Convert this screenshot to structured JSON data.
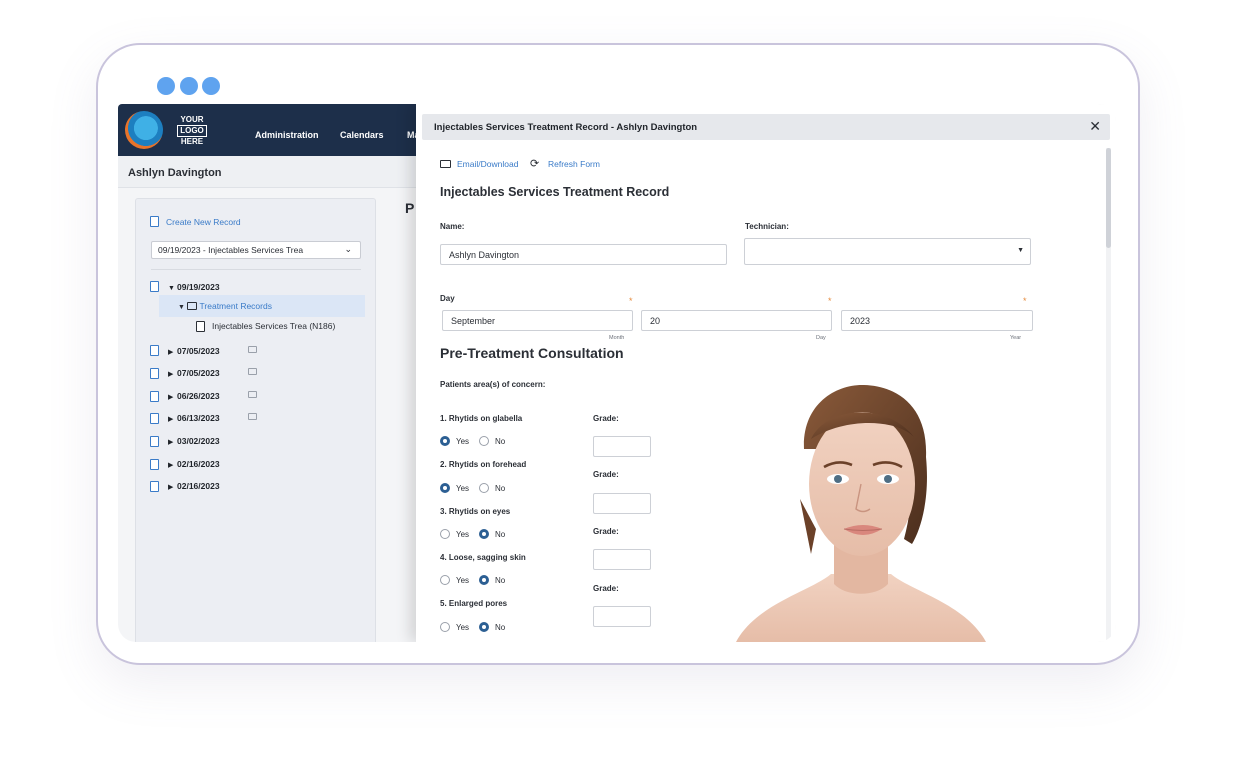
{
  "app": {
    "logo_text": [
      "YOUR",
      "LOGO",
      "HERE"
    ],
    "nav": [
      "Administration",
      "Calendars",
      "Ma"
    ],
    "patient_name": "Ashlyn Davington",
    "page_heading_stub": "P"
  },
  "sidebar": {
    "create_label": "Create New Record",
    "record_select": "09/19/2023 - Injectables Services Trea",
    "tree": {
      "open_date": "09/19/2023",
      "folder": "Treatment Records",
      "leaf": "Injectables Services Trea (N186)",
      "dates": [
        "07/05/2023",
        "07/05/2023",
        "06/26/2023",
        "06/13/2023",
        "03/02/2023",
        "02/16/2023",
        "02/16/2023"
      ]
    }
  },
  "modal": {
    "title": "Injectables Services Treatment Record - Ashlyn Davington",
    "close_glyph": "✕",
    "email_label": "Email/Download",
    "refresh_label": "Refresh Form",
    "form_title": "Injectables Services Treatment Record",
    "name_label": "Name:",
    "name_value": "Ashlyn Davington",
    "technician_label": "Technician:",
    "technician_value": "",
    "day_label": "Day",
    "month_value": "September",
    "day_value": "20",
    "year_value": "2023",
    "month_hint": "Month",
    "day_hint": "Day",
    "year_hint": "Year",
    "required_mark": "*",
    "section_title": "Pre-Treatment Consultation",
    "concern_label": "Patients area(s) of concern:",
    "grade_label": "Grade:",
    "yes_label": "Yes",
    "no_label": "No",
    "questions": [
      {
        "text": "1. Rhytids on glabella",
        "answer": "yes"
      },
      {
        "text": "2. Rhytids on forehead",
        "answer": "yes"
      },
      {
        "text": "3. Rhytids on eyes",
        "answer": "no"
      },
      {
        "text": "4. Loose, sagging skin",
        "answer": "no"
      },
      {
        "text": "5. Enlarged pores",
        "answer": "no"
      }
    ]
  },
  "colors": {
    "accent": "#3a7bc8",
    "topbar": "#1d2f4a",
    "radio_selected": "#2c5f93",
    "required": "#e58a3c"
  },
  "icons": [
    "document-icon",
    "folder-icon",
    "monitor-icon",
    "envelope-icon",
    "refresh-icon",
    "close-icon",
    "chevron-down-icon",
    "caret-down-icon"
  ]
}
